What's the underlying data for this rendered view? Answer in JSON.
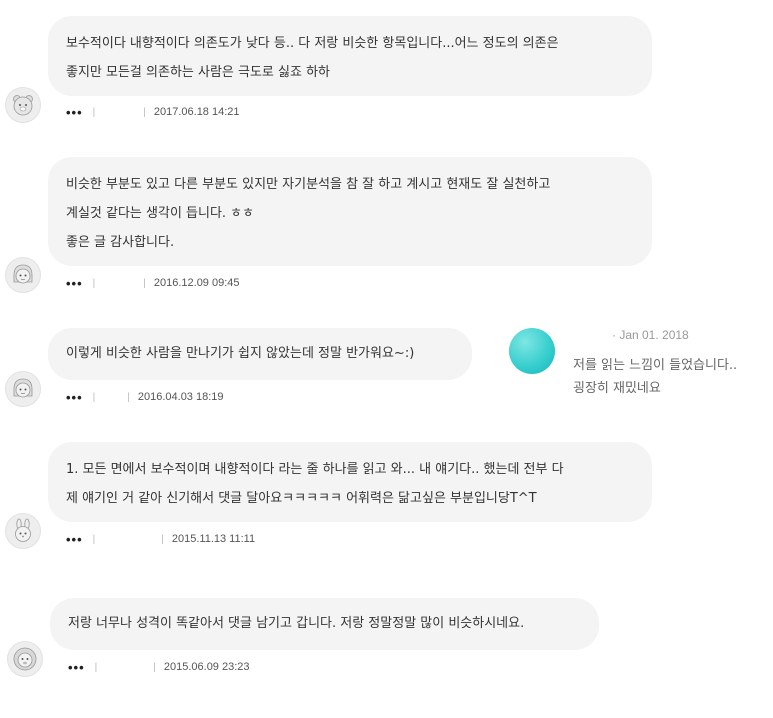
{
  "comments": [
    {
      "lines": [
        "보수적이다 내향적이다 의존도가 낮다 등.. 다 저랑 비슷한 항목입니다...어느 정도의 의존은",
        "좋지만 모든걸 의존하는 사람은 극도로 싫죠 하하"
      ],
      "more": "•••",
      "sep1": "|",
      "sep2": "|",
      "date": "2017.06.18 14:21",
      "avatar_icon": "bear-avatar-icon"
    },
    {
      "lines": [
        "비슷한 부분도 있고 다른 부분도 있지만 자기분석을 참 잘 하고 계시고 현재도 잘 실천하고",
        "계실것 같다는 생각이 듭니다. ㅎㅎ",
        "좋은 글 감사합니다."
      ],
      "more": "•••",
      "sep1": "|",
      "sep2": "|",
      "date": "2016.12.09 09:45",
      "avatar_icon": "girl-avatar-icon"
    },
    {
      "lines": [
        "이렇게 비슷한 사람을 만나기가 쉽지 않았는데 정말 반가워요~:)"
      ],
      "more": "•••",
      "sep1": "|",
      "sep2": "|",
      "date": "2016.04.03 18:19",
      "avatar_icon": "girl-avatar-icon"
    },
    {
      "lines": [
        "1. 모든 면에서 보수적이며 내향적이다 라는 줄 하나를 읽고 와... 내 얘기다.. 했는데 전부 다",
        "제 얘기인 거 같아 신기해서 댓글 달아요ㅋㅋㅋㅋㅋ 어휘력은 닮고싶은 부분입니당T^T"
      ],
      "more": "•••",
      "sep1": "|",
      "sep2": "|",
      "date": "2015.11.13 11:11",
      "avatar_icon": "rabbit-avatar-icon"
    },
    {
      "lines": [
        "저랑 너무나 성격이 똑같아서 댓글 남기고 갑니다. 저랑 정말정말 많이 비슷하시네요."
      ],
      "more": "•••",
      "sep1": "|",
      "sep2": "|",
      "date": "2015.06.09 23:23",
      "avatar_icon": "lion-avatar-icon"
    }
  ],
  "reply_preview": {
    "date": "· Jan 01. 2018",
    "lines": [
      "저를 읽는 느낌이 들었습니다..",
      "굉장히 재밌네요"
    ],
    "avatar_color": "#39cfcf"
  }
}
